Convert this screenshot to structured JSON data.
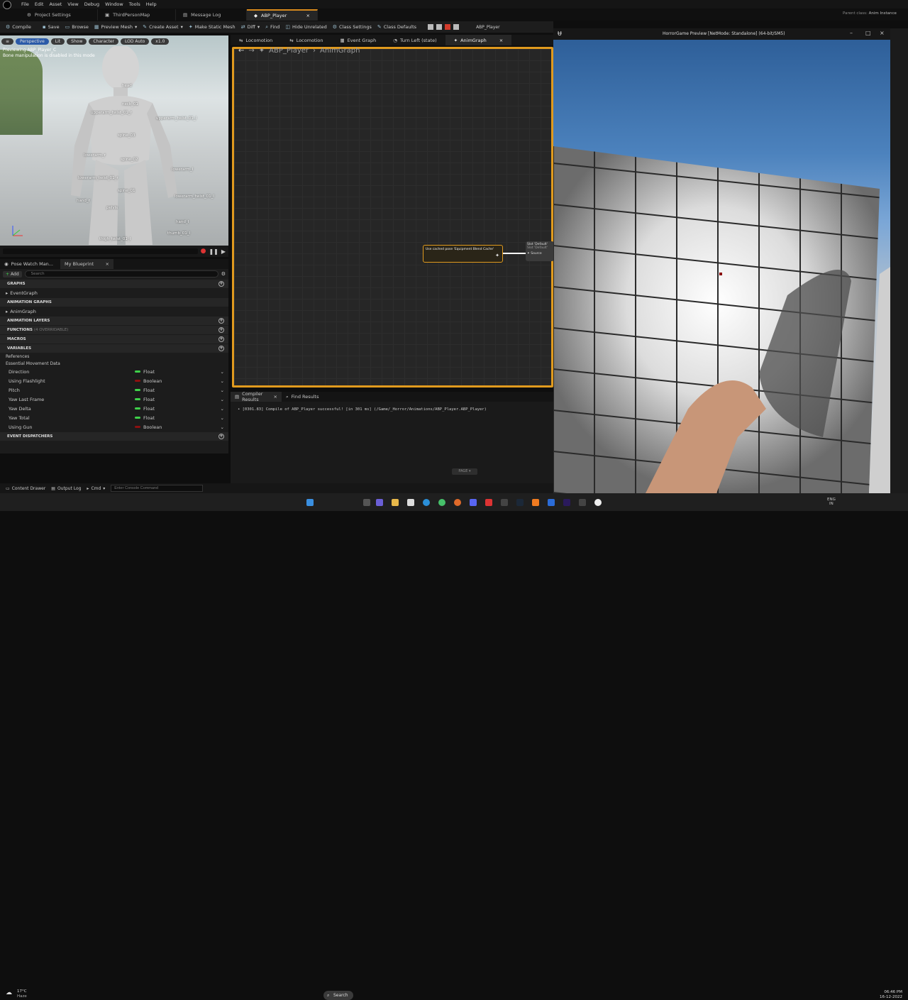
{
  "menu": [
    "File",
    "Edit",
    "Asset",
    "View",
    "Debug",
    "Window",
    "Tools",
    "Help"
  ],
  "doc_tabs": [
    {
      "label": "Project Settings",
      "active": false
    },
    {
      "label": "ThirdPersonMap",
      "active": false
    },
    {
      "label": "Message Log",
      "active": false
    },
    {
      "label": "ABP_Player",
      "active": true
    }
  ],
  "top_right": {
    "parent_class_label": "Parent class:",
    "parent_class_value": "Anim Instance"
  },
  "toolbar": [
    "Compile",
    "Save",
    "Browse",
    "Preview Mesh",
    "Create Asset",
    "Make Static Mesh",
    "Diff",
    "Find",
    "Hide Unrelated",
    "Class Settings",
    "Class Defaults"
  ],
  "toolbar_right": "ABP_Player",
  "viewport": {
    "buttons": [
      "Perspective",
      "Lit",
      "Show",
      "Character",
      "LOD Auto",
      "x1.0"
    ],
    "note_line1": "Previewing ABP_Player_C",
    "note_line2": "Bone manipulation is disabled in this mode",
    "bones": [
      "head",
      "neck_01",
      "upperarm_twist_01_r",
      "spine_03",
      "upperarm_twist_01_l",
      "lowerarm_l",
      "spine_02",
      "lowerarm_r",
      "spine_01",
      "lowerarm_twist_01_l",
      "lowerarm_twist_01_r",
      "hand_r",
      "pelvis",
      "hand_l",
      "thumb_01_l",
      "thigh_twist_01_l"
    ]
  },
  "panel_tabs": [
    "Pose Watch Man...",
    "My Blueprint"
  ],
  "mybp": {
    "add_label": "Add",
    "search_placeholder": "Search",
    "sections": {
      "graphs": "GRAPHS",
      "anim_graphs": "ANIMATION GRAPHS",
      "anim_layers": "ANIMATION LAYERS",
      "functions": "FUNCTIONS",
      "functions_note": "(4 OVERRIDABLE)",
      "macros": "MACROS",
      "variables": "VARIABLES",
      "dispatchers": "EVENT DISPATCHERS"
    },
    "event_graph": "EventGraph",
    "anim_graph": "AnimGraph",
    "var_groups": [
      "References",
      "Essential Movement Data"
    ],
    "variables": [
      {
        "name": "Direction",
        "type": "Float",
        "color": "#3fd14a"
      },
      {
        "name": "Using Flashlight",
        "type": "Boolean",
        "color": "#8c1010"
      },
      {
        "name": "Pitch",
        "type": "Float",
        "color": "#3fd14a"
      },
      {
        "name": "Yaw Last Frame",
        "type": "Float",
        "color": "#3fd14a"
      },
      {
        "name": "Yaw Delta",
        "type": "Float",
        "color": "#3fd14a"
      },
      {
        "name": "Yaw Total",
        "type": "Float",
        "color": "#3fd14a"
      },
      {
        "name": "Using Gun",
        "type": "Boolean",
        "color": "#8c1010"
      }
    ]
  },
  "graph_tabs": [
    {
      "label": "Locomotion",
      "active": false
    },
    {
      "label": "Locomotion",
      "active": false
    },
    {
      "label": "Event Graph",
      "active": false
    },
    {
      "label": "Turn Left (state)",
      "active": false
    },
    {
      "label": "AnimGraph",
      "active": true
    }
  ],
  "breadcrumb": {
    "root": "ABP_Player",
    "child": "AnimGraph"
  },
  "node": {
    "title": "Use cached pose 'Equipment Blend Cache'"
  },
  "node2": {
    "line1": "Slot 'Default'",
    "line2": "Slot 'Default'",
    "pin": "Source"
  },
  "compiler_tabs": [
    "Compiler Results",
    "Find Results"
  ],
  "compiler_message": "[0301.83] Compile of ABP_Player successful! [in 301 ms] (/Game/_Horror/Animations/ABP_Player.ABP_Player)",
  "page_label": "PAGE",
  "bottom": {
    "content_drawer": "Content Drawer",
    "output_log": "Output Log",
    "cmd": "Cmd",
    "console_placeholder": "Enter Console Command"
  },
  "game_window_title": "HorrorGame Preview [NetMode: Standalone]  (64-bit/SM5)",
  "taskbar": {
    "search": "Search",
    "weather_temp": "17°C",
    "weather_desc": "Haze",
    "lang1": "ENG",
    "lang2": "IN",
    "time": "06:46 PM",
    "date": "16-12-2022"
  },
  "colors": {
    "accent": "#e09a1e",
    "float_pin": "#3fd14a",
    "bool_pin": "#8c1010"
  }
}
